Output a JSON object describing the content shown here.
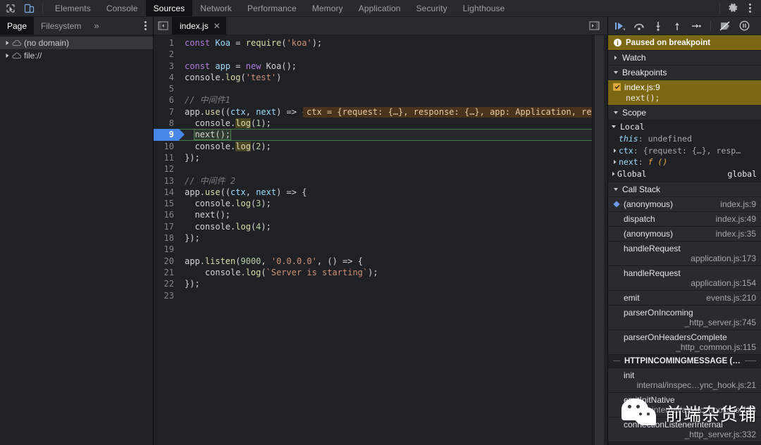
{
  "topbar": {
    "icons": [
      {
        "name": "inspect-element-icon",
        "label": "Inspect element"
      },
      {
        "name": "device-toolbar-icon",
        "label": "Toggle device toolbar"
      }
    ],
    "tabs": [
      {
        "label": "Elements",
        "active": false
      },
      {
        "label": "Console",
        "active": false
      },
      {
        "label": "Sources",
        "active": true
      },
      {
        "label": "Network",
        "active": false
      },
      {
        "label": "Performance",
        "active": false
      },
      {
        "label": "Memory",
        "active": false
      },
      {
        "label": "Application",
        "active": false
      },
      {
        "label": "Security",
        "active": false
      },
      {
        "label": "Lighthouse",
        "active": false
      }
    ],
    "settings_label": "Settings",
    "more_label": "Customize and control DevTools"
  },
  "navigator": {
    "tabs": [
      {
        "label": "Page",
        "active": true
      },
      {
        "label": "Filesystem",
        "active": false
      }
    ],
    "more_label": "»",
    "menu_label": "More options",
    "tree": [
      {
        "label": "(no domain)",
        "icon": "cloud-icon",
        "selected": true,
        "expanded": false
      },
      {
        "label": "file://",
        "icon": "cloud-icon",
        "selected": false,
        "expanded": false
      }
    ]
  },
  "editor": {
    "panel_toggle_label": "Hide navigator",
    "right_toggle_label": "Show debugger",
    "tab": {
      "label": "index.js",
      "close": "✕"
    },
    "execution_line": 9,
    "inline_eval": "ctx = {request: {…}, response: {…}, app: Application, req",
    "lines": [
      {
        "n": 1,
        "text": "const Koa = require('koa');"
      },
      {
        "n": 2,
        "text": ""
      },
      {
        "n": 3,
        "text": "const app = new Koa();"
      },
      {
        "n": 4,
        "text": "console.log('test')"
      },
      {
        "n": 5,
        "text": ""
      },
      {
        "n": 6,
        "text": "// 中间件1"
      },
      {
        "n": 7,
        "text": "app.use((ctx, next) => {"
      },
      {
        "n": 8,
        "text": "  console.log(1);"
      },
      {
        "n": 9,
        "text": "  next();"
      },
      {
        "n": 10,
        "text": "  console.log(2);"
      },
      {
        "n": 11,
        "text": "});"
      },
      {
        "n": 12,
        "text": ""
      },
      {
        "n": 13,
        "text": "// 中间件 2"
      },
      {
        "n": 14,
        "text": "app.use((ctx, next) => {"
      },
      {
        "n": 15,
        "text": "  console.log(3);"
      },
      {
        "n": 16,
        "text": "  next();"
      },
      {
        "n": 17,
        "text": "  console.log(4);"
      },
      {
        "n": 18,
        "text": "});"
      },
      {
        "n": 19,
        "text": ""
      },
      {
        "n": 20,
        "text": "app.listen(9000, '0.0.0.0', () => {"
      },
      {
        "n": 21,
        "text": "    console.log(`Server is starting`);"
      },
      {
        "n": 22,
        "text": "});"
      },
      {
        "n": 23,
        "text": ""
      }
    ]
  },
  "debugger": {
    "toolbar": [
      {
        "name": "resume-script-button",
        "label": "Resume script execution"
      },
      {
        "name": "step-over-button",
        "label": "Step over next function call"
      },
      {
        "name": "step-into-button",
        "label": "Step into next function call"
      },
      {
        "name": "step-out-button",
        "label": "Step out of current function"
      },
      {
        "name": "step-button",
        "label": "Step"
      },
      {
        "name": "deactivate-breakpoints-button",
        "label": "Deactivate breakpoints"
      },
      {
        "name": "pause-on-exceptions-button",
        "label": "Pause on exceptions"
      }
    ],
    "status": {
      "text": "Paused on breakpoint",
      "icon": "info-icon",
      "color": "#7c6713"
    },
    "watch": {
      "label": "Watch",
      "expanded": false
    },
    "breakpoints": {
      "label": "Breakpoints",
      "expanded": true,
      "items": [
        {
          "location": "index.js:9",
          "snippet": "next();",
          "checked": true,
          "active": true
        }
      ]
    },
    "scope": {
      "label": "Scope",
      "expanded": true,
      "local_label": "Local",
      "local": [
        {
          "name": "this",
          "value": "undefined",
          "italic": true,
          "expandable": false
        },
        {
          "name": "ctx",
          "value": "{request: {…}, resp…",
          "italic": false,
          "expandable": true
        },
        {
          "name": "next",
          "value": "f ()",
          "italic": false,
          "expandable": true,
          "is_function": true
        }
      ],
      "global_label": "Global",
      "global_value": "global"
    },
    "call_stack": {
      "label": "Call Stack",
      "expanded": true,
      "frames": [
        {
          "name": "(anonymous)",
          "location": "index.js:9",
          "current": true,
          "wrap": false
        },
        {
          "name": "dispatch",
          "location": "index.js:49",
          "current": false,
          "wrap": false
        },
        {
          "name": "(anonymous)",
          "location": "index.js:35",
          "current": false,
          "wrap": false
        },
        {
          "name": "handleRequest",
          "location": "application.js:173",
          "current": false,
          "wrap": true
        },
        {
          "name": "handleRequest",
          "location": "application.js:154",
          "current": false,
          "wrap": true
        },
        {
          "name": "emit",
          "location": "events.js:210",
          "current": false,
          "wrap": false
        },
        {
          "name": "parserOnIncoming",
          "location": "_http_server.js:745",
          "current": false,
          "wrap": true
        },
        {
          "name": "parserOnHeadersComplete",
          "location": "_http_common.js:115",
          "current": false,
          "wrap": true
        }
      ],
      "async_divider": "HTTPINCOMINGMESSAGE (…",
      "async_frames": [
        {
          "name": "init",
          "location": "internal/inspec…ync_hook.js:21",
          "current": false,
          "wrap": true
        },
        {
          "name": "emitInitNative",
          "location": "internal/async_hooks.js:134",
          "current": false,
          "wrap": true
        },
        {
          "name": "connectionListenerInternal",
          "location": "_http_server.js:332",
          "current": false,
          "wrap": true
        }
      ]
    }
  },
  "watermark": {
    "text": "前端杂货铺",
    "icon": "wechat-icon"
  }
}
